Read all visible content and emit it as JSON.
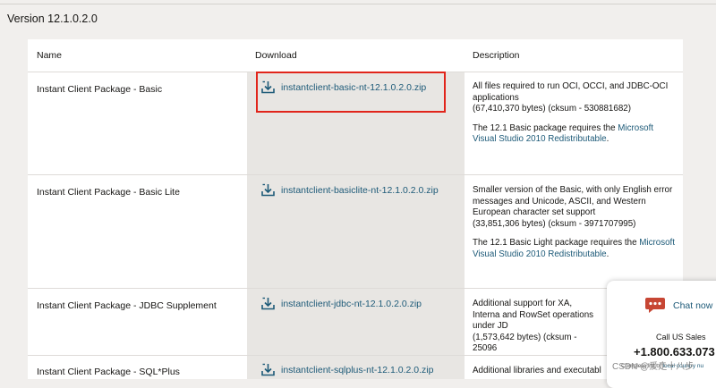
{
  "version_heading": "Version 12.1.0.2.0",
  "columns": {
    "name": "Name",
    "download": "Download",
    "description": "Description"
  },
  "rows": [
    {
      "name": "Instant Client Package - Basic",
      "file": "instantclient-basic-nt-12.1.0.2.0.zip",
      "desc1": "All files required to run OCI, OCCI, and JDBC-OCI applications",
      "desc2": "(67,410,370 bytes) (cksum - 530881682)",
      "req_prefix": "The 12.1 Basic package requires the ",
      "req_link": "Microsoft Visual Studio 2010 Redistributable",
      "req_suffix": "."
    },
    {
      "name": "Instant Client Package - Basic Lite",
      "file": "instantclient-basiclite-nt-12.1.0.2.0.zip",
      "desc1": "Smaller version of the Basic, with only English error messages and Unicode, ASCII, and Western European character set support",
      "desc2": "(33,851,306 bytes) (cksum - 3971707995)",
      "req_prefix": "The 12.1 Basic Light package requires the ",
      "req_link": "Microsoft Visual Studio 2010 Redistributable",
      "req_suffix": "."
    },
    {
      "name": "Instant Client Package - JDBC Supplement",
      "file": "instantclient-jdbc-nt-12.1.0.2.0.zip",
      "desc1": "Additional support for XA, Interna and RowSet operations under JD",
      "desc2": "(1,573,642 bytes) (cksum - 25096"
    },
    {
      "name": "Instant Client Package - SQL*Plus",
      "file": "instantclient-sqlplus-nt-12.1.0.2.0.zip",
      "desc1": "Additional libraries and executabl"
    }
  ],
  "chat": {
    "label": "Chat now",
    "sales_label": "Call US Sales",
    "phone": "+1.800.633.073",
    "complete_prefix": "Complete list of ",
    "complete_link": "local country nu"
  },
  "watermark": "CSDN @爱走十八步",
  "icons": {
    "download": "download-icon",
    "chat": "chat-bubble-icon"
  },
  "colors": {
    "link": "#1d5a78",
    "highlight": "#e1251b",
    "chat_icon": "#c74634"
  }
}
